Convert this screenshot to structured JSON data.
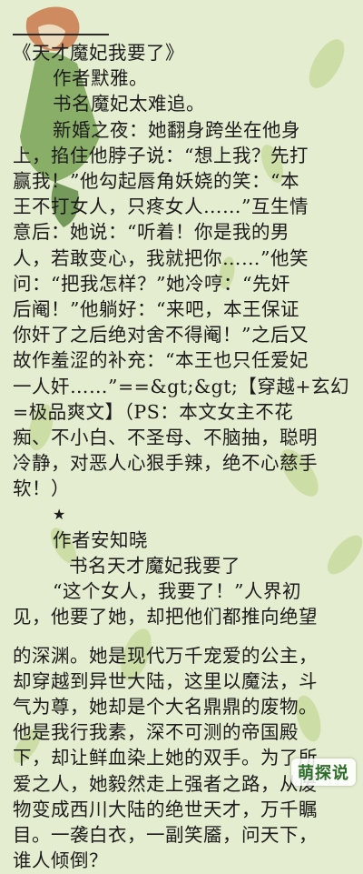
{
  "paragraph_1": {
    "title": "《天才魔妃我要了》",
    "author": "作者默雅。",
    "book": "书名魔妃太难追。",
    "lines": [
      "新婚之夜：她翻身跨坐在他身",
      "上，掐住他脖子说：“想上我？先打",
      "赢我！”他勾起唇角妖娆的笑：“本",
      "王不打女人，只疼女人……”互生情",
      "意后：她说：“听着！你是我的男",
      "人，若敢变心，我就把你……”他笑",
      "问：“把我怎样？”她冷哼：“先奸",
      "后阉！”他躺好：“来吧，本王保证",
      "你奸了之后绝对舍不得阉！”之后又",
      "故作羞涩的补充：“本王也只任爱妃",
      "一人奸……”==&gt;&gt;【穿越+玄幻",
      "=极品爽文】（PS：本文女主不花",
      "痴、不小白、不圣母、不脑抽，聪明",
      "冷静，对恶人心狠手辣，绝不心慈手",
      "软！）"
    ]
  },
  "separator": "★",
  "paragraph_2": {
    "author": "作者安知晓",
    "book": "书名天才魔妃我要了",
    "lines_a": [
      "“这个女人，我要了！”人界初",
      "见，他要了她，却把他们都推向绝望"
    ],
    "lines_b": [
      "的深渊。她是现代万千宠爱的公主，",
      "却穿越到异世大陆，这里以魔法，斗",
      "气为尊，她却是个大名鼎鼎的废物。",
      "他是我行我素，深不可测的帝国殿",
      "下，却让鲜血染上她的双手。为了所",
      "爱之人，她毅然走上强者之路，从废",
      "物变成西川大陆的绝世天才，万千瞩",
      "目。一袭白衣，一副笑靥，问天下，",
      "谁人倾倒？"
    ]
  },
  "watermark": "萌探说",
  "colors": {
    "background": "#e4edcf",
    "text": "#1c1c1c",
    "leaf": "#b9cf86"
  }
}
